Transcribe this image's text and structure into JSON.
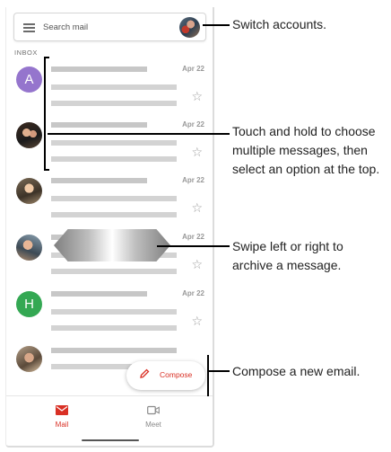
{
  "search": {
    "placeholder": "Search mail"
  },
  "inbox_label": "INBOX",
  "emails": [
    {
      "avatar_type": "letter",
      "letter": "A",
      "color": "#9575cd",
      "date": "Apr 22"
    },
    {
      "avatar_type": "photo",
      "date": "Apr 22"
    },
    {
      "avatar_type": "photo",
      "date": "Apr 22"
    },
    {
      "avatar_type": "photo",
      "date": "Apr 22"
    },
    {
      "avatar_type": "letter",
      "letter": "H",
      "color": "#34a853",
      "date": "Apr 22"
    },
    {
      "avatar_type": "photo",
      "date": ""
    }
  ],
  "compose_label": "Compose",
  "nav": {
    "mail": "Mail",
    "meet": "Meet"
  },
  "callouts": {
    "accounts": "Switch accounts.",
    "select_line1": "Touch and hold to choose",
    "select_line2": "multiple messages, then",
    "select_line3": "select an option at the top.",
    "swipe_line1": "Swipe left or right to",
    "swipe_line2": "archive a message.",
    "compose": "Compose a new email."
  },
  "colors": {
    "accent_red": "#d93025",
    "star_gray": "#9e9e9e"
  },
  "icons": [
    "menu-icon",
    "star-icon",
    "pencil-icon",
    "mail-icon",
    "video-icon"
  ]
}
